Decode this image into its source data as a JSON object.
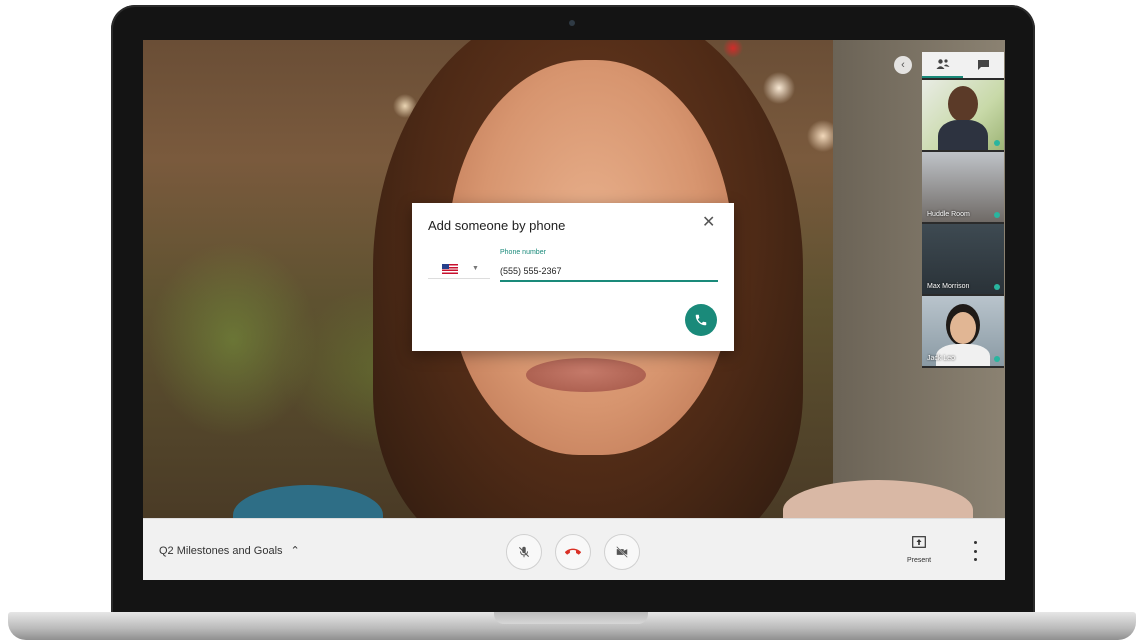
{
  "dialog": {
    "title": "Add someone by phone",
    "phone_label": "Phone number",
    "phone_value": "(555) 555-2367",
    "country": "United States",
    "country_flag_icon": "us-flag-icon"
  },
  "participants": [
    {
      "name": ""
    },
    {
      "name": "Huddle Room"
    },
    {
      "name": "Max Morrison"
    },
    {
      "name": "Jack Leo"
    }
  ],
  "panel": {
    "tabs": [
      "people-icon",
      "chat-icon"
    ]
  },
  "bottom_bar": {
    "meeting_title": "Q2 Milestones and Goals",
    "present_label": "Present"
  },
  "colors": {
    "accent": "#1a8a7a",
    "end_call": "#d93025"
  }
}
